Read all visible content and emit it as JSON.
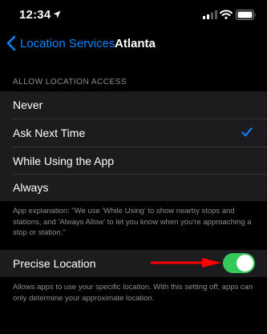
{
  "status_bar": {
    "time": "12:34",
    "icons": [
      "location-arrow-icon",
      "signal-icon",
      "wifi-icon",
      "battery-icon"
    ]
  },
  "nav": {
    "back_label": "Location Services",
    "title": "Atlanta"
  },
  "section": {
    "header": "ALLOW LOCATION ACCESS",
    "options": [
      {
        "label": "Never",
        "selected": false
      },
      {
        "label": "Ask Next Time",
        "selected": true
      },
      {
        "label": "While Using the App",
        "selected": false
      },
      {
        "label": "Always",
        "selected": false
      }
    ],
    "footer": "App explanation: \"We use 'While Using' to show nearby stops and stations, and 'Always Allow' to let you know when you're approaching a stop or station.\""
  },
  "precise_location": {
    "label": "Precise Location",
    "enabled": true,
    "footer": "Allows apps to use your specific location. With this setting off, apps can only determine your approximate location."
  },
  "colors": {
    "accent": "#0a84ff",
    "toggle_on": "#34c759",
    "annotation_arrow": "#ff0000",
    "background": "#000000",
    "cell": "#1c1c1e",
    "secondary_text": "#8d8d93"
  }
}
